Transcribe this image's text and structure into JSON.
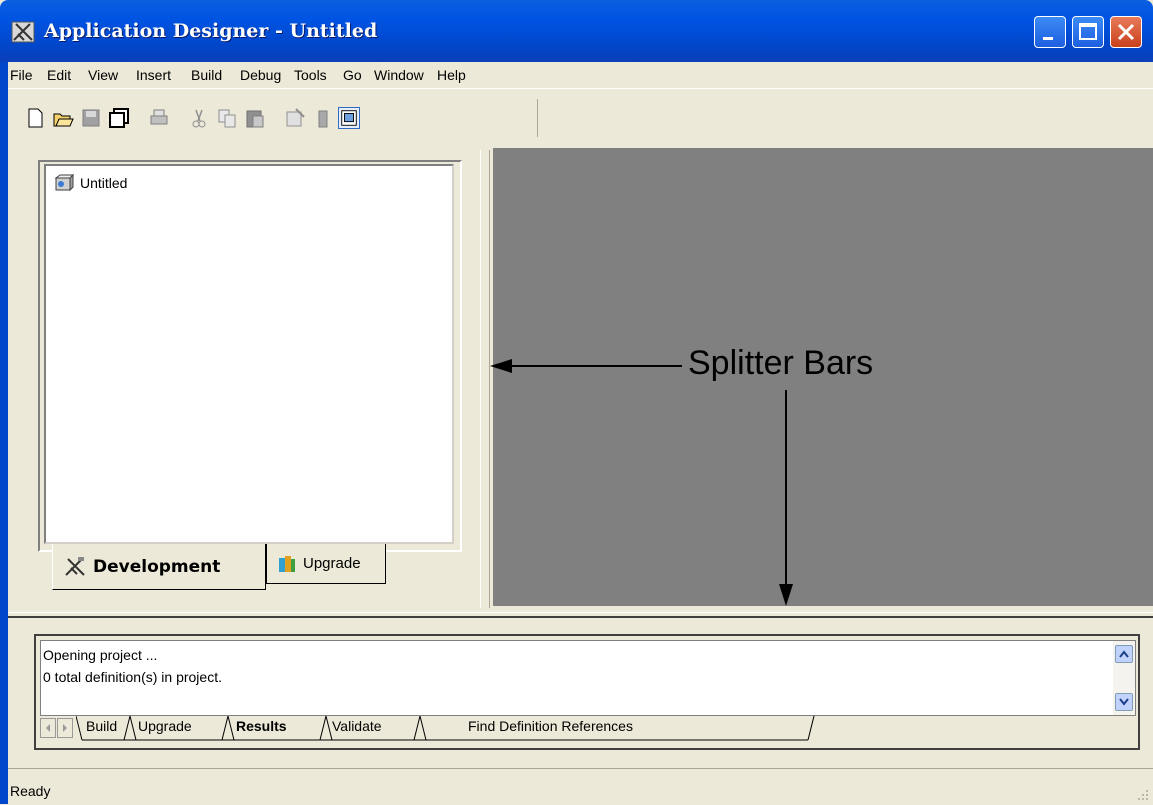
{
  "window": {
    "title": "Application Designer - Untitled",
    "title_color": "#0054e3"
  },
  "menu": [
    "File",
    "Edit",
    "View",
    "Insert",
    "Build",
    "Debug",
    "Tools",
    "Go",
    "Window",
    "Help"
  ],
  "toolbar": {
    "icons": [
      "new-icon",
      "open-icon",
      "save-icon",
      "save-all-icon",
      "print-icon",
      "cut-icon",
      "copy-icon",
      "paste-icon",
      "properties-icon",
      "compile-icon",
      "project-workspace-icon"
    ]
  },
  "workspace": {
    "tree_root": "Untitled",
    "tabs": [
      {
        "label": "Development",
        "active": true
      },
      {
        "label": "Upgrade",
        "active": false
      }
    ]
  },
  "annotation": {
    "label": "Splitter Bars"
  },
  "output": {
    "lines": [
      "Opening project ...",
      "0  total definition(s) in project."
    ],
    "tabs": [
      {
        "label": "Build",
        "active": false
      },
      {
        "label": "Upgrade",
        "active": false
      },
      {
        "label": "Results",
        "active": true
      },
      {
        "label": "Validate",
        "active": false
      },
      {
        "label": "Find Definition References",
        "active": false
      }
    ]
  },
  "status": {
    "text": "Ready"
  }
}
